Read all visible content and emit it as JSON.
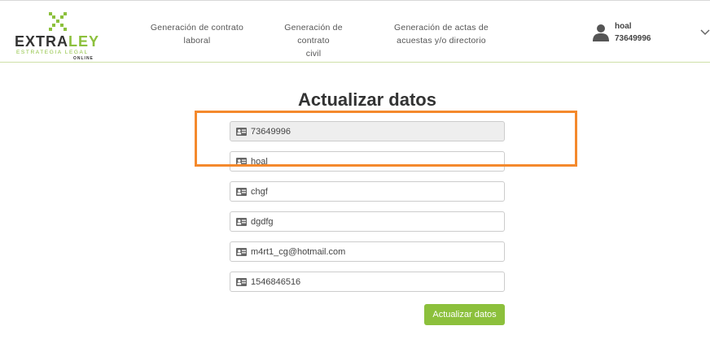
{
  "brand": {
    "name_part1": "EXTRA",
    "name_part2": "LEY",
    "tagline": "ESTRATEGIA LEGAL",
    "sub": "ONLINE",
    "accent_color": "#8cc03c"
  },
  "nav": {
    "items": [
      {
        "label_line1": "Generación de contrato",
        "label_line2": "laboral"
      },
      {
        "label_line1": "Generación de contrato",
        "label_line2": "civil"
      },
      {
        "label_line1": "Generación de actas de",
        "label_line2": "acuestas y/o directorio"
      }
    ]
  },
  "user": {
    "name": "hoal",
    "id": "73649996",
    "icon": "user-icon"
  },
  "form": {
    "title": "Actualizar datos",
    "fields": [
      {
        "value": "73649996",
        "readonly": true,
        "icon": "id-card-icon"
      },
      {
        "value": "hoal",
        "readonly": false,
        "icon": "id-card-icon"
      },
      {
        "value": "chgf",
        "readonly": false,
        "icon": "id-card-icon"
      },
      {
        "value": "dgdfg",
        "readonly": false,
        "icon": "id-card-icon"
      },
      {
        "value": "m4rt1_cg@hotmail.com",
        "readonly": false,
        "icon": "id-card-icon"
      },
      {
        "value": "1546846516",
        "readonly": false,
        "icon": "id-card-icon"
      }
    ],
    "submit_label": "Actualizar datos"
  },
  "annotation": {
    "color": "#f4892c"
  }
}
